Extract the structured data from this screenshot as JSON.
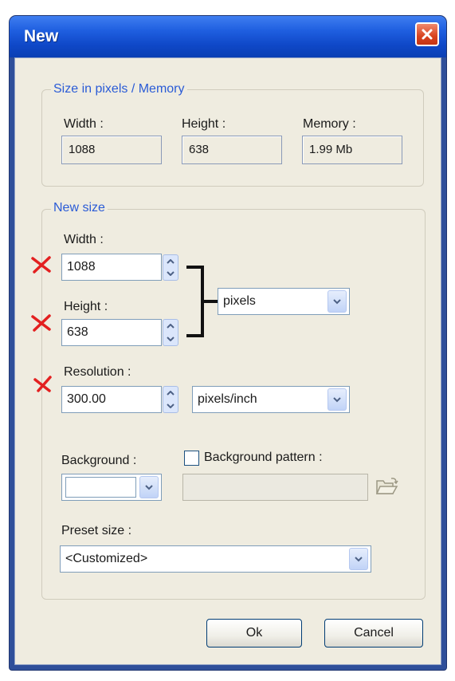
{
  "window": {
    "title": "New"
  },
  "size_memory": {
    "group_title": "Size in pixels / Memory",
    "width_label": "Width :",
    "width_value": "1088",
    "height_label": "Height :",
    "height_value": "638",
    "memory_label": "Memory :",
    "memory_value": "1.99 Mb"
  },
  "new_size": {
    "group_title": "New size",
    "width_label": "Width :",
    "width_value": "1088",
    "height_label": "Height :",
    "height_value": "638",
    "unit_selected": "pixels",
    "resolution_label": "Resolution :",
    "resolution_value": "300.00",
    "resolution_unit_selected": "pixels/inch",
    "background_label": "Background :",
    "background_color": "#ffffff",
    "background_pattern_label": "Background pattern :",
    "background_pattern_checked": false,
    "preset_label": "Preset size :",
    "preset_selected": "<Customized>"
  },
  "buttons": {
    "ok": "Ok",
    "cancel": "Cancel"
  },
  "colors": {
    "titlebar": "#0f48c8",
    "client_bg": "#efece0",
    "group_title": "#2a5bd6",
    "annotation_mark": "#e32020",
    "close_button": "#d8431f"
  },
  "icons": {
    "close": "close-icon",
    "spin": "spin-arrows-icon",
    "dropdown": "chevron-down-icon",
    "folder": "folder-open-icon",
    "annotation": "x-mark-icon",
    "bracket": "bracket-icon"
  }
}
